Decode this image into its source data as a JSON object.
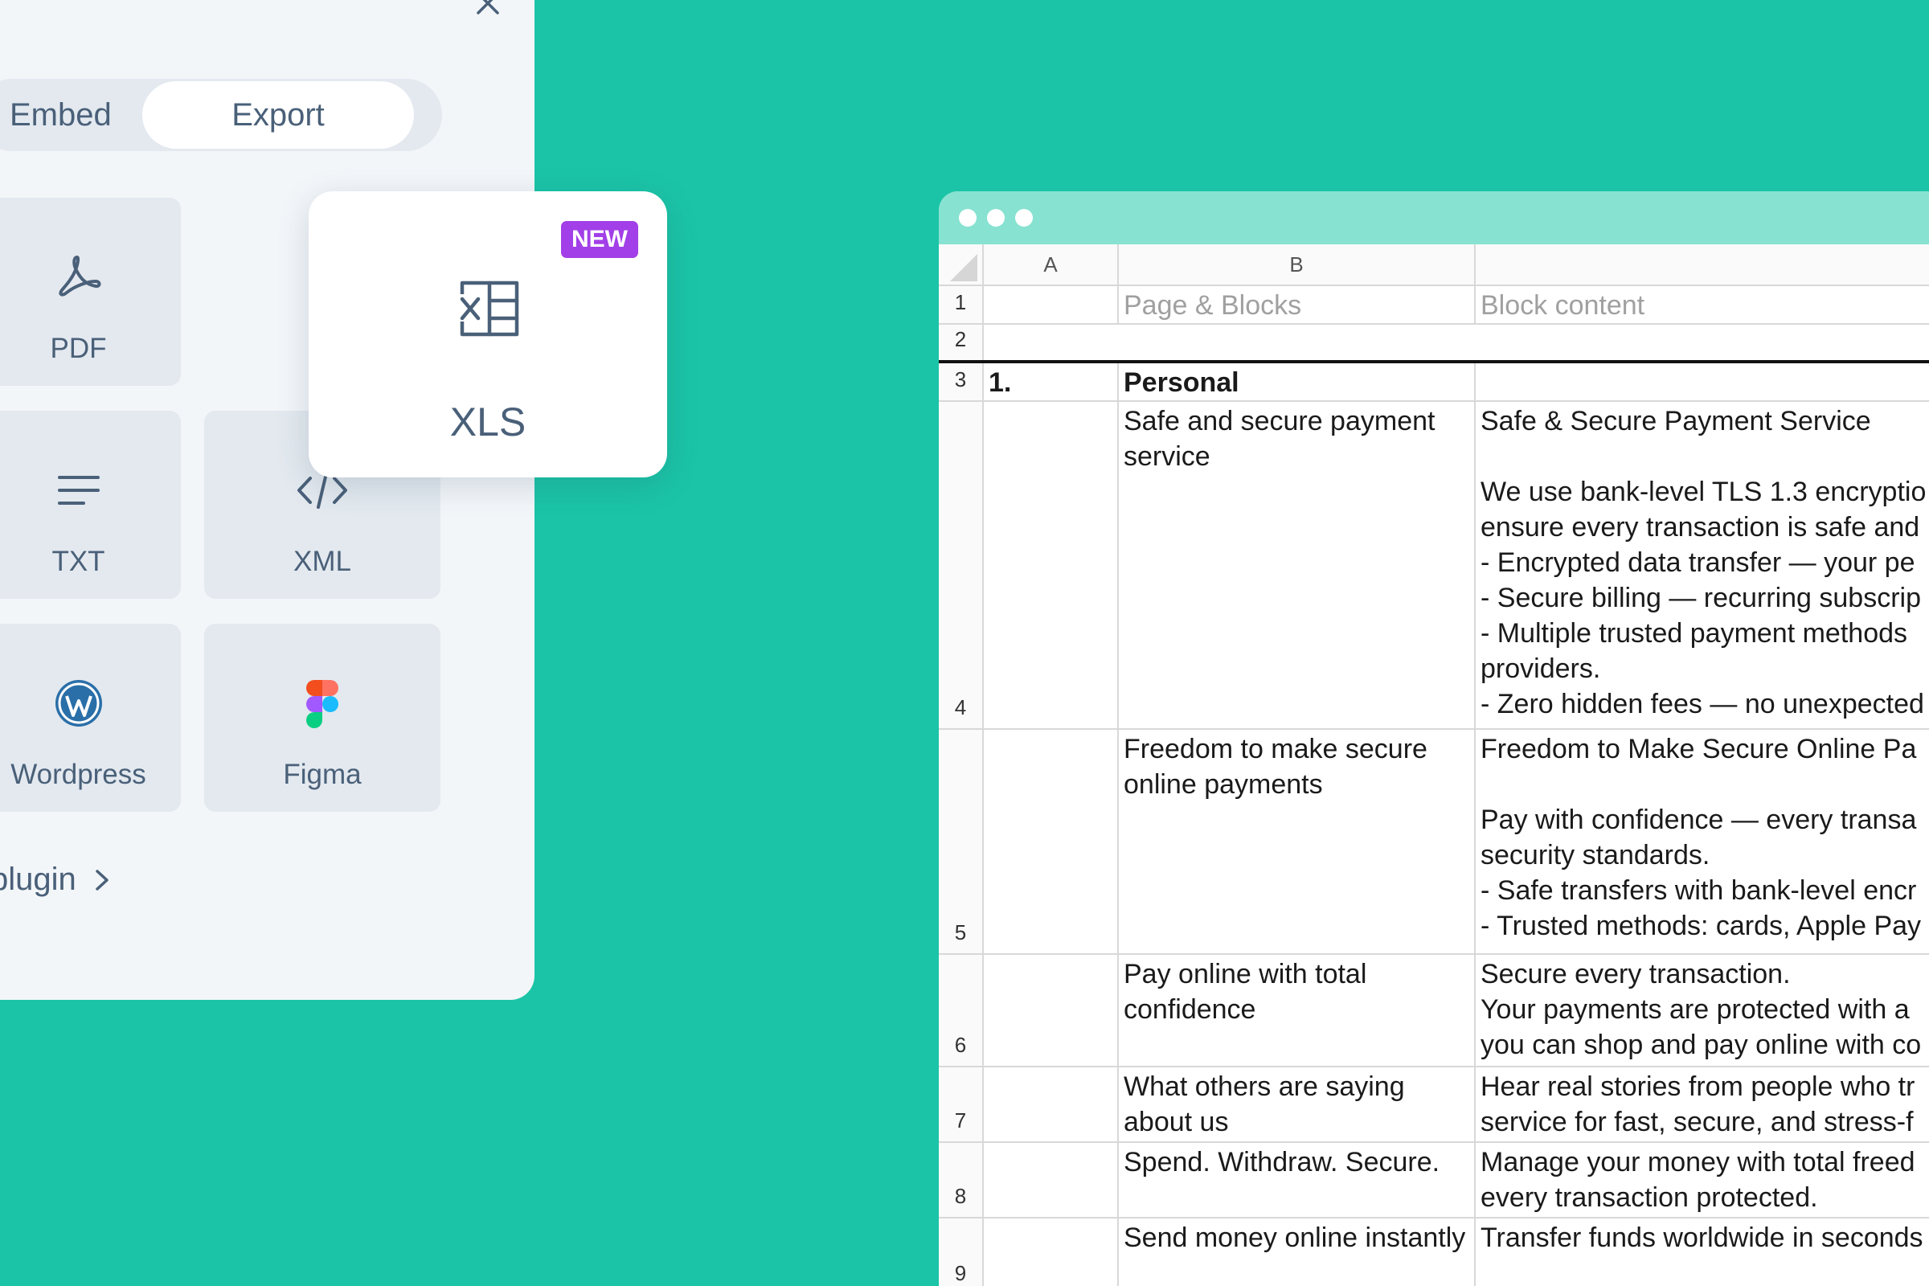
{
  "panel": {
    "tabs": [
      {
        "label": "Embed"
      },
      {
        "label": "Export",
        "selected": true
      }
    ],
    "tiles": {
      "pdf": {
        "label": "PDF",
        "icon": "acrobat-icon"
      },
      "txt": {
        "label": "TXT",
        "icon": "lines-icon"
      },
      "xml": {
        "label": "XML",
        "icon": "code-icon"
      },
      "wordpress": {
        "label": "Wordpress",
        "icon": "wordpress-icon"
      },
      "figma": {
        "label": "Figma",
        "icon": "figma-icon"
      }
    },
    "plugin_link": "plugin",
    "xls_card": {
      "label": "XLS",
      "badge": "NEW",
      "icon": "spreadsheet-icon"
    }
  },
  "colors": {
    "background": "#1bc4a7",
    "titlebar": "#87e2d1",
    "badge": "#a23fe8",
    "panel_text": "#4a6079"
  },
  "sheet": {
    "columns": [
      "A",
      "B",
      ""
    ],
    "rows": [
      {
        "num": "1",
        "a": "",
        "b": "Page & Blocks",
        "c": "Block content"
      },
      {
        "num": "2",
        "a": "",
        "b": "",
        "c": ""
      },
      {
        "num": "3",
        "a": "1.",
        "b": "Personal",
        "c": ""
      },
      {
        "num": "4",
        "a": "",
        "b": "Safe and secure payment service",
        "c": "Safe & Secure Payment Service\n\nWe use bank-level TLS 1.3 encryptio\nensure every transaction is safe and\n- Encrypted data transfer — your pe\n- Secure billing — recurring subscrip\n- Multiple trusted payment methods\nproviders.\n- Zero hidden fees — no unexpected"
      },
      {
        "num": "5",
        "a": "",
        "b": "Freedom to make secure online payments",
        "c": "Freedom to Make Secure Online Pa\n\nPay with confidence — every transa\nsecurity standards.\n- Safe transfers with bank-level encr\n- Trusted methods: cards, Apple Pay"
      },
      {
        "num": "6",
        "a": "",
        "b": "Pay online with total confidence",
        "c": "Secure every transaction.\nYour payments are protected with a\nyou can shop and pay online with co"
      },
      {
        "num": "7",
        "a": "",
        "b": "What others are saying about us",
        "c": "Hear real stories from people who tr\nservice for fast, secure, and stress-f"
      },
      {
        "num": "8",
        "a": "",
        "b": "Spend. Withdraw. Secure.",
        "c": "Manage your money with total freed\nevery transaction protected."
      },
      {
        "num": "9",
        "a": "",
        "b": "Send money online instantly",
        "c": "Transfer funds worldwide in seconds"
      }
    ]
  }
}
